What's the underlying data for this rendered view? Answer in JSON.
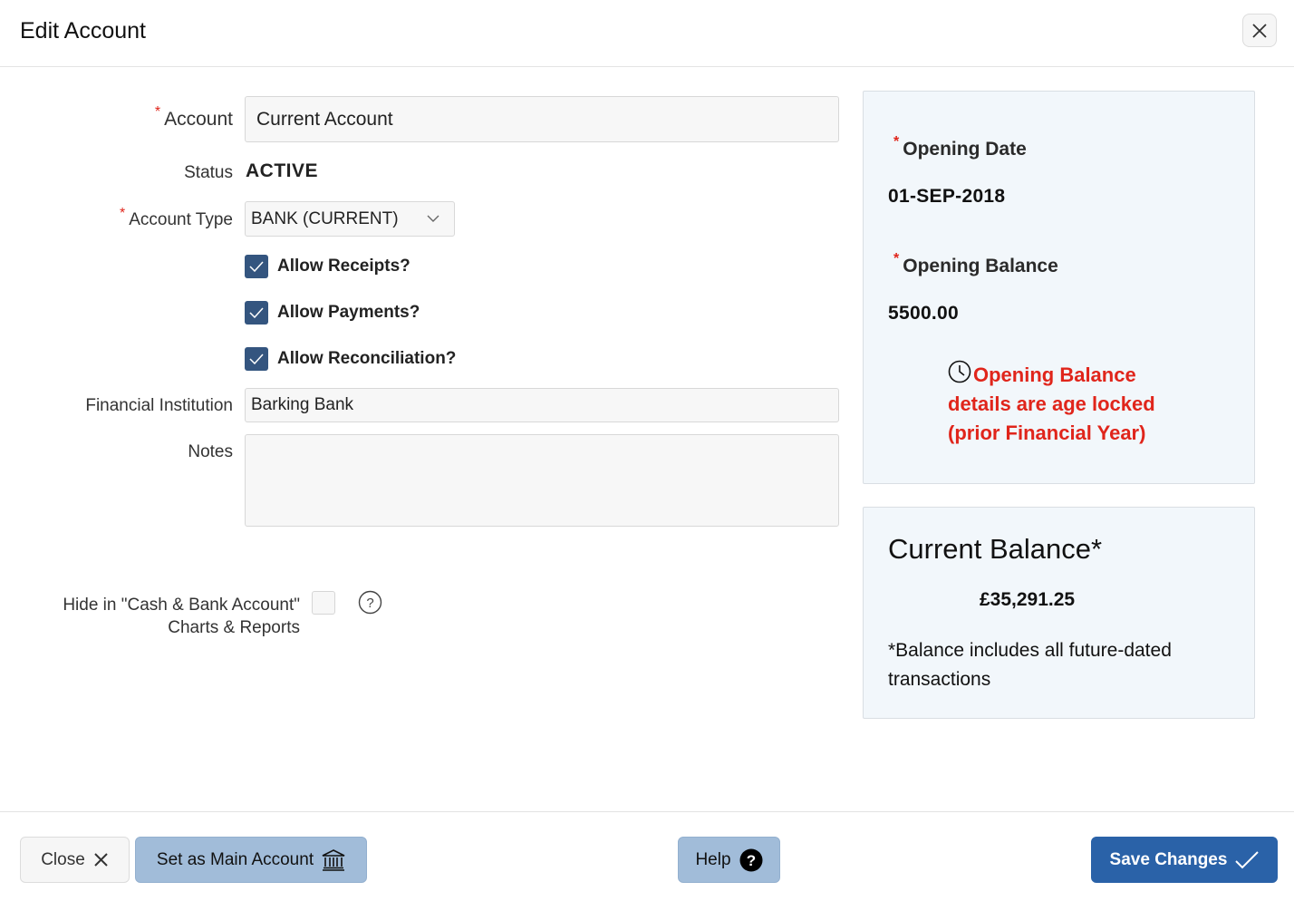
{
  "dialog": {
    "title": "Edit Account",
    "close_icon": "close-icon"
  },
  "form": {
    "account": {
      "label": "Account",
      "required_mark": "*",
      "value": "Current Account"
    },
    "status": {
      "label": "Status",
      "value": "ACTIVE"
    },
    "account_type": {
      "label": "Account Type",
      "required_mark": "*",
      "value": "BANK (CURRENT)"
    },
    "checkboxes": [
      {
        "label": "Allow Receipts?",
        "checked": true
      },
      {
        "label": "Allow Payments?",
        "checked": true
      },
      {
        "label": "Allow Reconciliation?",
        "checked": true
      }
    ],
    "financial_institution": {
      "label": "Financial Institution",
      "value": "Barking Bank"
    },
    "notes": {
      "label": "Notes",
      "value": ""
    },
    "hide_option": {
      "label_line1": "Hide in \"Cash & Bank Account\"",
      "label_line2": "Charts & Reports",
      "checked": false,
      "help_icon": "question-circle-icon"
    }
  },
  "opening_panel": {
    "date_label": "Opening Date",
    "date_required": "*",
    "date_value": "01-SEP-2018",
    "balance_label": "Opening Balance",
    "balance_required": "*",
    "balance_value": "5500.00",
    "lock_icon": "clock-icon",
    "lock_message": "Opening Balance details are age locked (prior Financial Year)"
  },
  "balance_panel": {
    "title": "Current Balance*",
    "amount": "£35,291.25",
    "note": "*Balance includes all future-dated transactions"
  },
  "footer": {
    "close_label": "Close",
    "main_account_label": "Set as Main Account",
    "help_label": "Help",
    "save_label": "Save Changes"
  },
  "colors": {
    "primary": "#2a62a8",
    "soft_button": "#a1bcd9",
    "checkbox": "#34557f",
    "warning": "#e0251b",
    "panel_bg": "#f2f7fb"
  }
}
